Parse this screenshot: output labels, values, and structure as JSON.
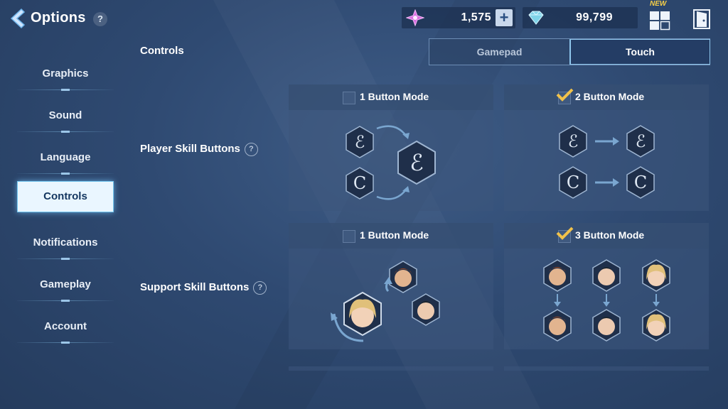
{
  "header": {
    "title": "Options",
    "help": "?",
    "currency1": "1,575",
    "currency1_add": "+",
    "currency2": "99,799",
    "new_badge": "NEW"
  },
  "sidebar": {
    "items": [
      {
        "label": "Graphics",
        "active": false
      },
      {
        "label": "Sound",
        "active": false
      },
      {
        "label": "Language",
        "active": false
      },
      {
        "label": "Controls",
        "active": true
      },
      {
        "label": "Notifications",
        "active": false
      },
      {
        "label": "Gameplay",
        "active": false
      },
      {
        "label": "Account",
        "active": false
      }
    ]
  },
  "main": {
    "section_title": "Controls",
    "toggle": {
      "gamepad": "Gamepad",
      "touch": "Touch",
      "selected": "Touch"
    },
    "rows": [
      {
        "label": "Player Skill Buttons",
        "help": "?",
        "options": [
          {
            "label": "1 Button Mode",
            "selected": false
          },
          {
            "label": "2 Button Mode",
            "selected": true
          }
        ]
      },
      {
        "label": "Support Skill Buttons",
        "help": "?",
        "options": [
          {
            "label": "1 Button Mode",
            "selected": false
          },
          {
            "label": "3 Button Mode",
            "selected": true
          }
        ]
      }
    ]
  },
  "colors": {
    "accent": "#8fc6ec",
    "active_tab_bg": "#eaf6ff",
    "check_gold": "#f2c24a",
    "background": "#2f4a72"
  }
}
